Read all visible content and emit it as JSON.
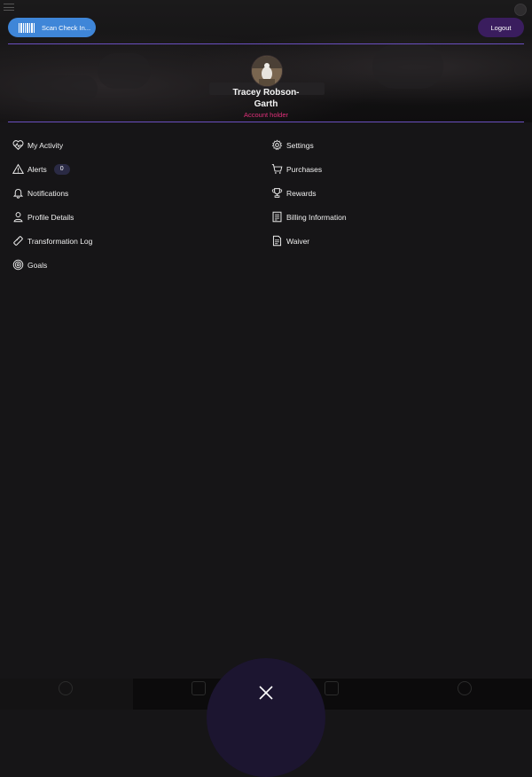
{
  "header": {
    "scan_label": "Scan Check In...",
    "logout_label": "Logout"
  },
  "profile": {
    "name": "Tracey Robson-Garth",
    "role": "Account holder",
    "role_color": "#e0307a"
  },
  "menu_left": [
    {
      "label": "My Activity",
      "icon": "heart-pulse-icon"
    },
    {
      "label": "Alerts",
      "icon": "warning-icon",
      "badge": "0"
    },
    {
      "label": "Notifications",
      "icon": "bell-icon"
    },
    {
      "label": "Profile Details",
      "icon": "person-icon"
    },
    {
      "label": "Transformation Log",
      "icon": "ruler-icon"
    },
    {
      "label": "Goals",
      "icon": "target-icon"
    }
  ],
  "menu_right": [
    {
      "label": "Settings",
      "icon": "gear-icon"
    },
    {
      "label": "Purchases",
      "icon": "cart-icon"
    },
    {
      "label": "Rewards",
      "icon": "trophy-icon"
    },
    {
      "label": "Billing Information",
      "icon": "billing-icon"
    },
    {
      "label": "Waiver",
      "icon": "document-icon"
    }
  ],
  "colors": {
    "accent_blue": "#3f86d8",
    "accent_purple": "#3a1d5e",
    "divider": "#6a4fc0"
  }
}
